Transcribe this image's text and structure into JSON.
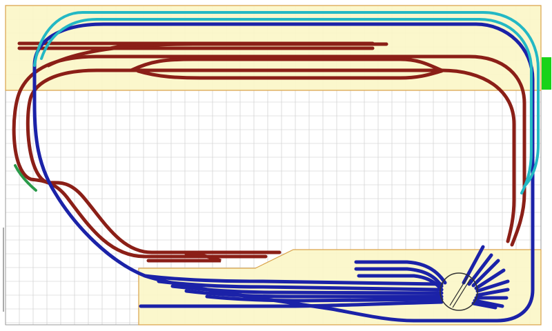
{
  "title": "",
  "colors": {
    "background": "#ffffff",
    "grid": "#c8c8c8",
    "board_fill": "#fbf6c8",
    "board_stroke": "#d9a24a",
    "track_red": "#8b1f17",
    "track_red_highlight": "#e03a2a",
    "track_blue": "#1b22a8",
    "track_cyan": "#23b8c4",
    "track_green": "#2a9a4a",
    "connector_green": "#19d319",
    "turntable_stroke": "#333333"
  },
  "icons": {
    "connector": "green-connector-marker",
    "turntable": "turntable-icon"
  }
}
